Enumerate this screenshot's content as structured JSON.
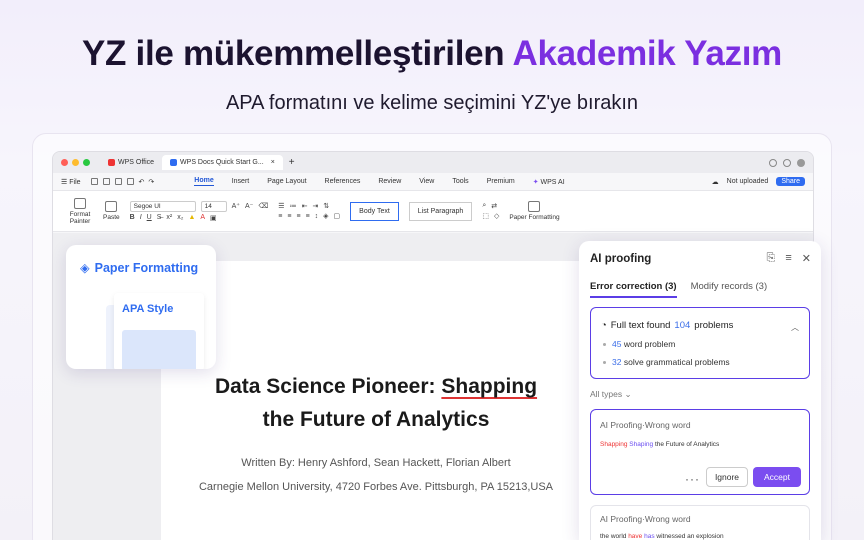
{
  "headline": {
    "part1": "YZ ile mükemmelleştirilen ",
    "highlight": "Akademik Yazım"
  },
  "subheadline": "APA formatını ve kelime seçimini YZ'ye bırakın",
  "colors": {
    "accent": "#7b2fe0",
    "primary_blue": "#2f6cf0",
    "ai_purple": "#5b3ee6",
    "error_red": "#e33"
  },
  "window": {
    "tabs": [
      {
        "label": "WPS Office",
        "icon": "wps-logo-icon"
      },
      {
        "label": "WPS Docs Quick Start G...",
        "icon": "doc-icon"
      }
    ],
    "menu": {
      "file": "File",
      "items": [
        "Home",
        "Insert",
        "Page Layout",
        "References",
        "Review",
        "View",
        "Tools",
        "Premium",
        "WPS AI"
      ],
      "active": "Home",
      "not_uploaded": "Not uploaded",
      "share": "Share"
    },
    "ribbon": {
      "format_painter": "Format Painter",
      "paste": "Paste",
      "font": "Segoe UI",
      "size": "14",
      "style1": "Body Text",
      "style2": "List Paragraph",
      "paper_formatting": "Paper Formatting"
    }
  },
  "document": {
    "title_line1_a": "Data Science Pioneer: ",
    "title_line1_b": "Shapping",
    "title_line2": "the Future of Analytics",
    "authors": "Written By: Henry Ashford, Sean Hackett, Florian Albert",
    "affiliation": "Carnegie Mellon University, 4720 Forbes Ave. Pittsburgh, PA 15213,USA"
  },
  "paper_card": {
    "title": "Paper Formatting",
    "style_label": "APA Style"
  },
  "ai_panel": {
    "title": "AI proofing",
    "tabs": [
      {
        "label": "Error correction (3)",
        "active": true
      },
      {
        "label": "Modify records (3)",
        "active": false
      }
    ],
    "summary": {
      "prefix": "Full text found",
      "count": "104",
      "suffix": "problems",
      "word_count": "45",
      "word_label": "word problem",
      "grammar_count": "32",
      "grammar_label": "solve grammatical problems"
    },
    "filter": "All types",
    "cards": [
      {
        "title": "AI Proofing·Wrong word",
        "wrong": "Shapping",
        "fix": "Shaping",
        "rest": " the Future of Analytics",
        "ignore": "Ignore",
        "accept": "Accept",
        "more": "···"
      },
      {
        "title": "AI Proofing·Wrong word",
        "pre": "the world ",
        "wrong": "have",
        "fix": "has",
        "rest": " witnessed an explosion"
      }
    ]
  }
}
